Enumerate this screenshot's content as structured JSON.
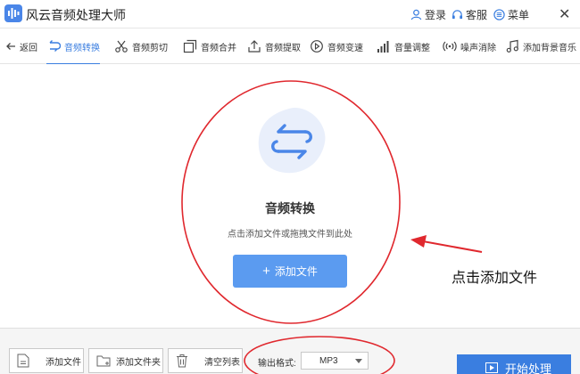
{
  "app": {
    "title": "风云音频处理大师"
  },
  "titlebar": {
    "login": "登录",
    "service": "客服",
    "menu": "菜单",
    "close": "✕"
  },
  "toolbar": {
    "back": "返回",
    "items": [
      "音频转换",
      "音频剪切",
      "音频合并",
      "音频提取",
      "音频变速",
      "音量调整",
      "噪声消除",
      "添加背景音乐"
    ],
    "active": "音频转换"
  },
  "main": {
    "title": "音频转换",
    "hint": "点击添加文件或拖拽文件到此处",
    "add_label": "添加文件"
  },
  "callout": {
    "text": "点击添加文件"
  },
  "bottom": {
    "add_file": "添加文件",
    "add_folder": "添加文件夹",
    "clear_list": "清空列表",
    "format_label": "输出格式:",
    "format_value": "MP3",
    "start": "开始处理"
  },
  "colors": {
    "accent": "#3a7ee0",
    "button": "#5b9bf0",
    "annotation": "#e0282e"
  }
}
